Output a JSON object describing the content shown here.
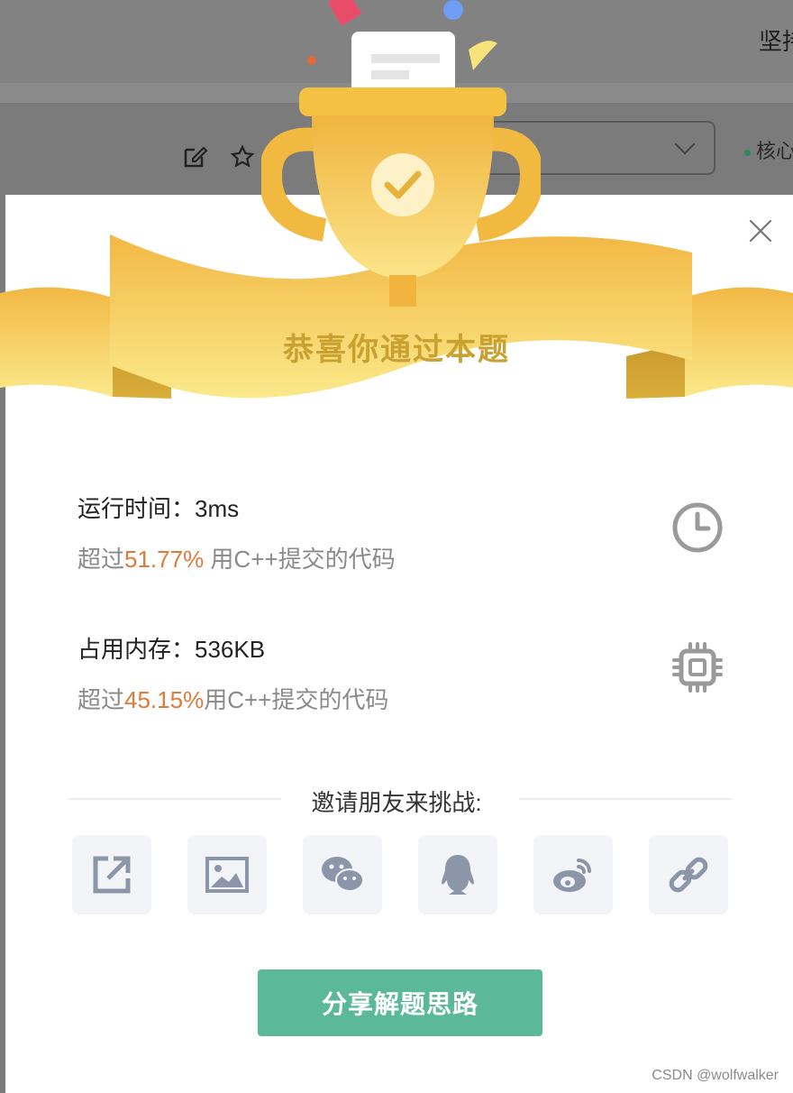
{
  "background": {
    "page_title": "坚持",
    "tag": "核心"
  },
  "dialog": {
    "banner_title": "恭喜你通过本题",
    "runtime": {
      "label": "运行时间：",
      "value": "3ms",
      "prefix": "超过",
      "percent": "51.77%",
      "suffix": " 用C++提交的代码"
    },
    "memory": {
      "label": "占用内存：",
      "value": "536KB",
      "prefix": "超过",
      "percent": "45.15%",
      "suffix": "用C++提交的代码"
    },
    "invite_title": "邀请朋友来挑战:",
    "share_icons": [
      "external-link-icon",
      "image-icon",
      "wechat-icon",
      "qq-icon",
      "weibo-icon",
      "link-icon"
    ],
    "cta_label": "分享解题思路"
  },
  "watermark": "CSDN @wolfwalker",
  "colors": {
    "accent_green": "#5bb99a",
    "highlight_orange": "#e07a3a",
    "ribbon_gold": "#f4c95a",
    "banner_text": "#c8a131"
  }
}
